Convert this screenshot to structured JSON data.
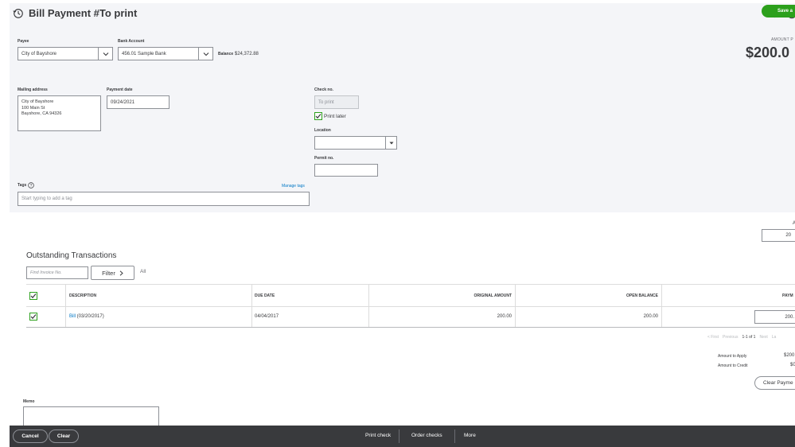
{
  "header": {
    "title": "Bill Payment #To print"
  },
  "payee": {
    "label": "Payee",
    "value": "City of Bayshore"
  },
  "bank_account": {
    "label": "Bank Account",
    "value": "456.01 Sample Bank",
    "balance_label": "Balance",
    "balance_value": "$24,372.88"
  },
  "amount": {
    "label": "AMOUNT P",
    "value": "$200.0"
  },
  "mailing_address": {
    "label": "Mailing address",
    "lines": [
      "City of Bayshore",
      "100 Main St",
      "Bayshore, CA 94326"
    ]
  },
  "payment_date": {
    "label": "Payment date",
    "value": "09/24/2021"
  },
  "check_no": {
    "label": "Check no.",
    "value": "To print"
  },
  "print_later": {
    "label": "Print later",
    "checked": true
  },
  "location": {
    "label": "Location",
    "value": ""
  },
  "permit_no": {
    "label": "Permit no.",
    "value": ""
  },
  "tags": {
    "label": "Tags",
    "manage_label": "Manage tags",
    "placeholder": "Start typing to add a tag"
  },
  "right_side": {
    "label_fragment": "A",
    "input_value": "20"
  },
  "outstanding": {
    "title": "Outstanding Transactions",
    "search_placeholder": "Find Invoice No.",
    "filter_label": "Filter",
    "all_label": "All",
    "columns": [
      "DESCRIPTION",
      "DUE DATE",
      "ORIGINAL AMOUNT",
      "OPEN BALANCE",
      "PAYM"
    ],
    "rows": [
      {
        "desc_link": "Bill",
        "desc_rest": " (03/20/2017)",
        "due_date": "04/04/2017",
        "original": "200.00",
        "open": "200.00",
        "payment": "200."
      }
    ]
  },
  "pagination": {
    "first": "< First",
    "previous": "Previous",
    "range": "1-1 of 1",
    "next": "Next",
    "last": "La"
  },
  "totals": {
    "apply_label": "Amount to Apply",
    "apply_value": "$200",
    "credit_label": "Amount to Credit",
    "credit_value": "$0",
    "clear_button": "Clear Payme"
  },
  "memo": {
    "label": "Memo"
  },
  "footer": {
    "cancel": "Cancel",
    "clear": "Clear",
    "print_check": "Print check",
    "order_checks": "Order checks",
    "more": "More",
    "save": "Save a"
  },
  "colors": {
    "accent_green": "#2ca01c",
    "link_blue": "#0077c5",
    "panel_bg": "#f4f5f8",
    "footer_bg": "#393a3d"
  }
}
